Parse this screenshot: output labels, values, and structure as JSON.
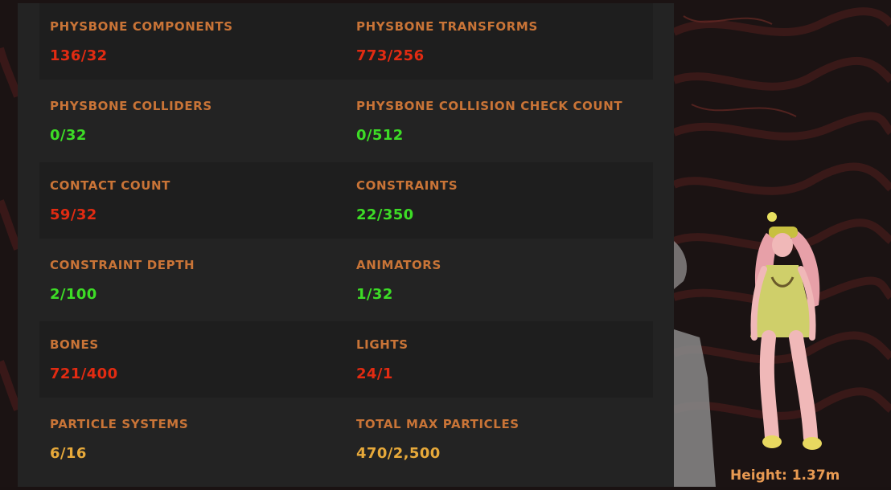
{
  "stats": [
    {
      "left_label": "PHYSBONE COMPONENTS",
      "left_value": "136/32",
      "right_label": "PHYSBONE TRANSFORMS",
      "right_value": "773/256"
    },
    {
      "left_label": "PHYSBONE COLLIDERS",
      "left_value": "0/32",
      "right_label": "PHYSBONE COLLISION CHECK COUNT",
      "right_value": "0/512"
    },
    {
      "left_label": "CONTACT COUNT",
      "left_value": "59/32",
      "right_label": "CONSTRAINTS",
      "right_value": "22/350"
    },
    {
      "left_label": "CONSTRAINT DEPTH",
      "left_value": "2/100",
      "right_label": "ANIMATORS",
      "right_value": "1/32"
    },
    {
      "left_label": "BONES",
      "left_value": "721/400",
      "right_label": "LIGHTS",
      "right_value": "24/1"
    },
    {
      "left_label": "PARTICLE SYSTEMS",
      "left_value": "6/16",
      "right_label": "TOTAL MAX PARTICLES",
      "right_value": "470/2,500"
    }
  ],
  "colors": {
    "label": "#c97437",
    "over_limit": "#e22b12",
    "within_limit": "#3ddc26",
    "warning": "#e7a93a"
  },
  "avatar": {
    "height_text": "Height: 1.37m",
    "figure_icon": "avatar-figure-icon"
  }
}
